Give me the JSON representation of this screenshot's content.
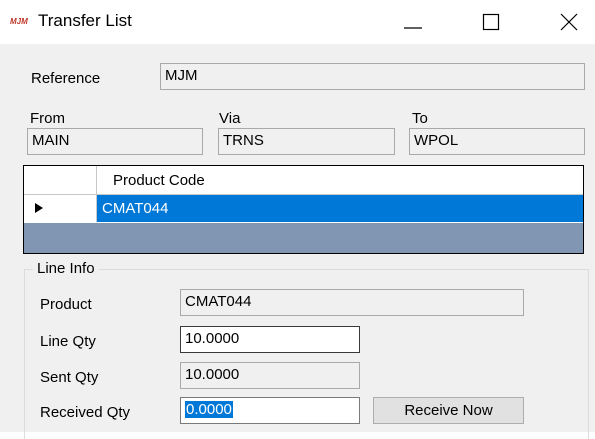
{
  "window": {
    "logo_text": "MJM",
    "title": "Transfer List",
    "controls": [
      "minimize",
      "maximize",
      "close"
    ]
  },
  "reference": {
    "label": "Reference",
    "value": "MJM"
  },
  "route": {
    "from": {
      "label": "From",
      "value": "MAIN"
    },
    "via": {
      "label": "Via",
      "value": "TRNS"
    },
    "to": {
      "label": "To",
      "value": "WPOL"
    }
  },
  "grid": {
    "columns": [
      "Product Code"
    ],
    "rows": [
      {
        "product_code": "CMAT044",
        "selected": true,
        "current": true
      }
    ]
  },
  "line_info": {
    "title": "Line Info",
    "product": {
      "label": "Product",
      "value": "CMAT044"
    },
    "line_qty": {
      "label": "Line Qty",
      "value": "10.0000"
    },
    "sent_qty": {
      "label": "Sent Qty",
      "value": "10.0000"
    },
    "received_qty": {
      "label": "Received Qty",
      "value": "0.0000"
    },
    "receive_button_label": "Receive Now"
  },
  "colors": {
    "selection": "#0078d7",
    "grid_background": "#8196b3",
    "window_background": "#f0f0f0",
    "logo": "#c0392b"
  }
}
